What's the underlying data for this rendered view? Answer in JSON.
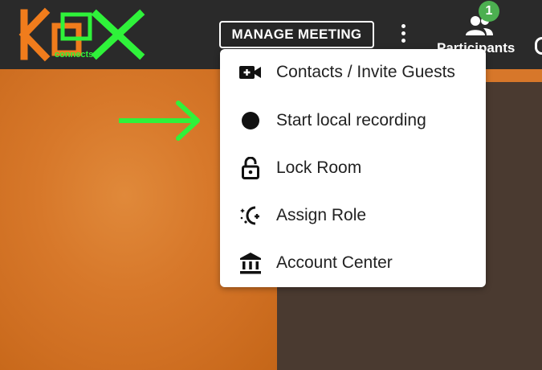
{
  "header": {
    "logo": {
      "main_text": "KOX",
      "sub_text": "connects"
    },
    "manage_meeting_label": "MANAGE MEETING",
    "participants_label": "Participants",
    "participants_count": "1"
  },
  "menu": {
    "items": [
      {
        "label": "Contacts / Invite Guests",
        "icon": "video-add-icon"
      },
      {
        "label": "Start local recording",
        "icon": "record-dot-icon"
      },
      {
        "label": "Lock Room",
        "icon": "lock-open-icon"
      },
      {
        "label": "Assign Role",
        "icon": "assign-role-icon"
      },
      {
        "label": "Account Center",
        "icon": "bank-icon"
      }
    ]
  },
  "colors": {
    "topbar": "#2a2a2a",
    "accent_green": "#2ff23a",
    "logo_orange": "#f07c1c",
    "badge_green": "#4caf50",
    "video_orange": "#d7782a",
    "video_dark": "#4a3a30"
  }
}
